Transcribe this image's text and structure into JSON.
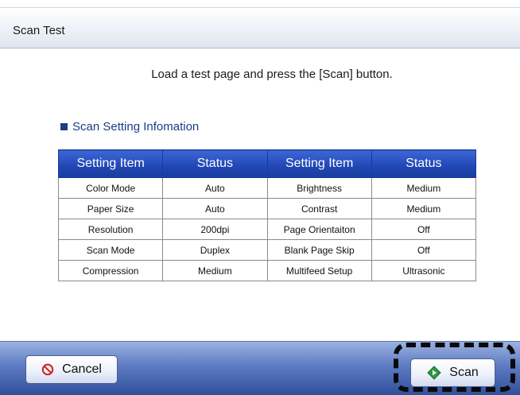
{
  "window": {
    "title": "Scan Test"
  },
  "main": {
    "instruction": "Load a test page and press the [Scan] button.",
    "section_title": "Scan Setting Infomation",
    "table": {
      "headers": [
        "Setting Item",
        "Status",
        "Setting Item",
        "Status"
      ],
      "rows": [
        [
          "Color Mode",
          "Auto",
          "Brightness",
          "Medium"
        ],
        [
          "Paper Size",
          "Auto",
          "Contrast",
          "Medium"
        ],
        [
          "Resolution",
          "200dpi",
          "Page Orientaiton",
          "Off"
        ],
        [
          "Scan Mode",
          "Duplex",
          "Blank Page Skip",
          "Off"
        ],
        [
          "Compression",
          "Medium",
          "Multifeed Setup",
          "Ultrasonic"
        ]
      ]
    }
  },
  "footer": {
    "cancel_label": "Cancel",
    "scan_label": "Scan"
  },
  "colors": {
    "header_blue": "#2046b4",
    "section_blue": "#1f3c88",
    "cancel_icon_red": "#d0201a",
    "scan_icon_green": "#2e9a3c"
  },
  "icons": {
    "cancel": "prohibited-icon",
    "scan": "diamond-start-icon"
  }
}
